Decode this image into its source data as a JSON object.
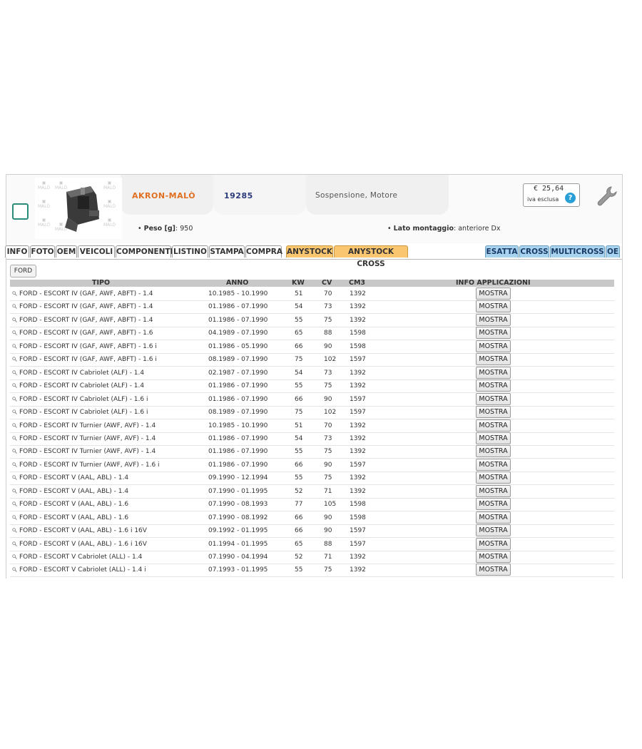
{
  "product": {
    "brand": "AKRON-MALÒ",
    "code": "19285",
    "description": "Sospensione, Motore",
    "price": "€ 25,64",
    "price_note": "iva esclusa",
    "help_glyph": "?",
    "weight_label": "Peso [g]",
    "weight_value": ": 950",
    "mount_label": "Lato montaggio",
    "mount_value": ": anteriore Dx"
  },
  "tabs": {
    "left": [
      "INFO",
      "FOTO",
      "OEM",
      "VEICOLI",
      "COMPONENTI",
      "LISTINO",
      "STAMPA",
      "COMPRA"
    ],
    "orange": [
      "ANYSTOCK",
      "ANYSTOCK CROSS"
    ],
    "right": [
      "ESATTA",
      "CROSS",
      "MULTICROSS",
      "OE"
    ]
  },
  "filter_button": "FORD",
  "table": {
    "headers": {
      "tipo": "TIPO",
      "anno": "ANNO",
      "kw": "KW",
      "cv": "CV",
      "cm3": "CM3",
      "info": "INFO APPLICAZIONI"
    },
    "button_label": "MOSTRA",
    "rows": [
      {
        "tipo": "FORD - ESCORT IV (GAF, AWF, ABFT) - 1.4",
        "anno": "10.1985 - 10.1990",
        "kw": "51",
        "cv": "70",
        "cm3": "1392"
      },
      {
        "tipo": "FORD - ESCORT IV (GAF, AWF, ABFT) - 1.4",
        "anno": "01.1986 - 07.1990",
        "kw": "54",
        "cv": "73",
        "cm3": "1392"
      },
      {
        "tipo": "FORD - ESCORT IV (GAF, AWF, ABFT) - 1.4",
        "anno": "01.1986 - 07.1990",
        "kw": "55",
        "cv": "75",
        "cm3": "1392"
      },
      {
        "tipo": "FORD - ESCORT IV (GAF, AWF, ABFT) - 1.6",
        "anno": "04.1989 - 07.1990",
        "kw": "65",
        "cv": "88",
        "cm3": "1598"
      },
      {
        "tipo": "FORD - ESCORT IV (GAF, AWF, ABFT) - 1.6 i",
        "anno": "01.1986 - 05.1990",
        "kw": "66",
        "cv": "90",
        "cm3": "1598"
      },
      {
        "tipo": "FORD - ESCORT IV (GAF, AWF, ABFT) - 1.6 i",
        "anno": "08.1989 - 07.1990",
        "kw": "75",
        "cv": "102",
        "cm3": "1597"
      },
      {
        "tipo": "FORD - ESCORT IV Cabriolet (ALF) - 1.4",
        "anno": "02.1987 - 07.1990",
        "kw": "54",
        "cv": "73",
        "cm3": "1392"
      },
      {
        "tipo": "FORD - ESCORT IV Cabriolet (ALF) - 1.4",
        "anno": "01.1986 - 07.1990",
        "kw": "55",
        "cv": "75",
        "cm3": "1392"
      },
      {
        "tipo": "FORD - ESCORT IV Cabriolet (ALF) - 1.6 i",
        "anno": "01.1986 - 07.1990",
        "kw": "66",
        "cv": "90",
        "cm3": "1597"
      },
      {
        "tipo": "FORD - ESCORT IV Cabriolet (ALF) - 1.6 i",
        "anno": "08.1989 - 07.1990",
        "kw": "75",
        "cv": "102",
        "cm3": "1597"
      },
      {
        "tipo": "FORD - ESCORT IV Turnier (AWF, AVF) - 1.4",
        "anno": "10.1985 - 10.1990",
        "kw": "51",
        "cv": "70",
        "cm3": "1392"
      },
      {
        "tipo": "FORD - ESCORT IV Turnier (AWF, AVF) - 1.4",
        "anno": "01.1986 - 07.1990",
        "kw": "54",
        "cv": "73",
        "cm3": "1392"
      },
      {
        "tipo": "FORD - ESCORT IV Turnier (AWF, AVF) - 1.4",
        "anno": "01.1986 - 07.1990",
        "kw": "55",
        "cv": "75",
        "cm3": "1392"
      },
      {
        "tipo": "FORD - ESCORT IV Turnier (AWF, AVF) - 1.6 i",
        "anno": "01.1986 - 07.1990",
        "kw": "66",
        "cv": "90",
        "cm3": "1597"
      },
      {
        "tipo": "FORD - ESCORT V (AAL, ABL) - 1.4",
        "anno": "09.1990 - 12.1994",
        "kw": "55",
        "cv": "75",
        "cm3": "1392"
      },
      {
        "tipo": "FORD - ESCORT V (AAL, ABL) - 1.4",
        "anno": "07.1990 - 01.1995",
        "kw": "52",
        "cv": "71",
        "cm3": "1392"
      },
      {
        "tipo": "FORD - ESCORT V (AAL, ABL) - 1.6",
        "anno": "07.1990 - 08.1993",
        "kw": "77",
        "cv": "105",
        "cm3": "1598"
      },
      {
        "tipo": "FORD - ESCORT V (AAL, ABL) - 1.6",
        "anno": "07.1990 - 08.1992",
        "kw": "66",
        "cv": "90",
        "cm3": "1598"
      },
      {
        "tipo": "FORD - ESCORT V (AAL, ABL) - 1.6 i 16V",
        "anno": "09.1992 - 01.1995",
        "kw": "66",
        "cv": "90",
        "cm3": "1597"
      },
      {
        "tipo": "FORD - ESCORT V (AAL, ABL) - 1.6 i 16V",
        "anno": "01.1994 - 01.1995",
        "kw": "65",
        "cv": "88",
        "cm3": "1597"
      },
      {
        "tipo": "FORD - ESCORT V Cabriolet (ALL) - 1.4",
        "anno": "07.1990 - 04.1994",
        "kw": "52",
        "cv": "71",
        "cm3": "1392"
      },
      {
        "tipo": "FORD - ESCORT V Cabriolet (ALL) - 1.4 i",
        "anno": "07.1993 - 01.1995",
        "kw": "55",
        "cv": "75",
        "cm3": "1392"
      }
    ]
  },
  "colors": {
    "brand": "#e07020",
    "code": "#2b3a7a",
    "tab_orange": "#fbc670",
    "tab_blue": "#a9d4f0",
    "checkbox": "#2a8d7a",
    "help": "#2a9fd6"
  },
  "icons": {
    "row": "magnifier-icon",
    "tool": "wrench-icon",
    "help": "help-icon"
  }
}
